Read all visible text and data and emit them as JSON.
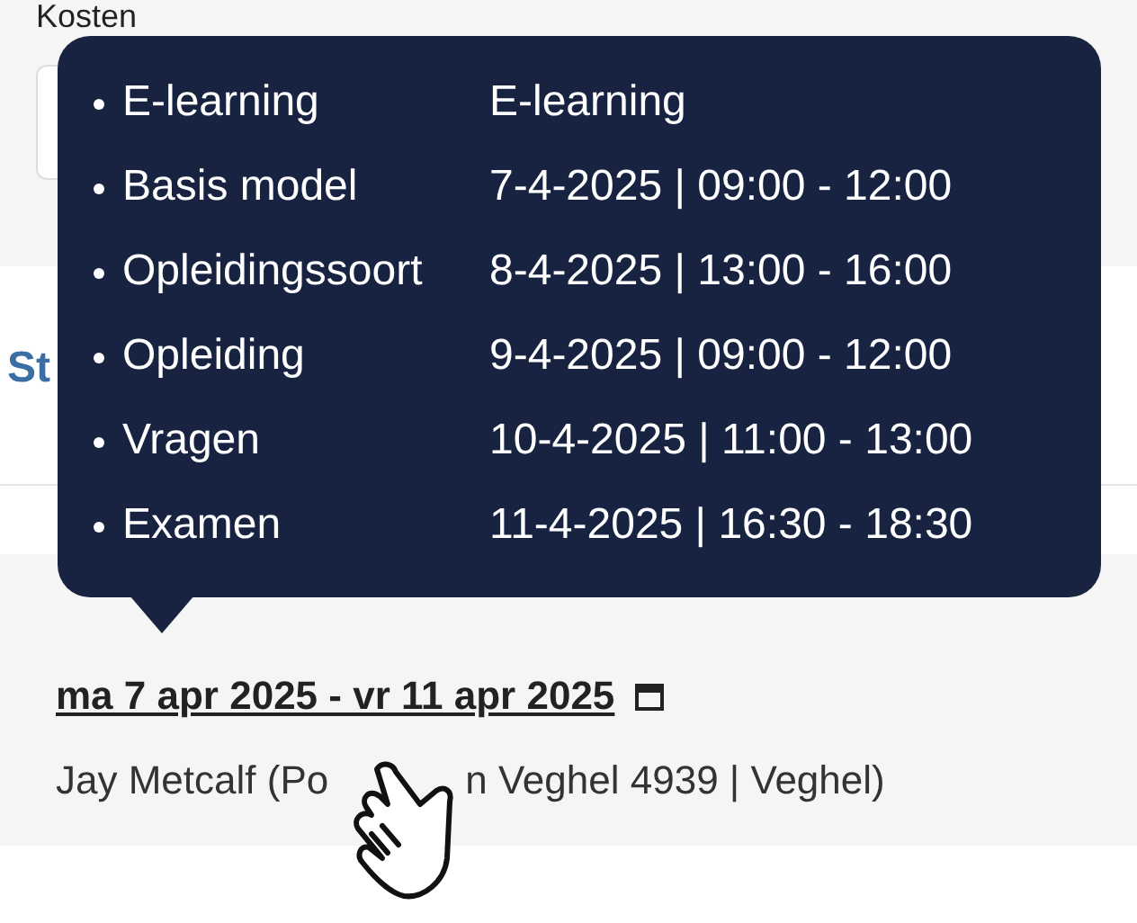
{
  "section_label": "Kosten",
  "section_heading": "St",
  "tooltip": {
    "rows": [
      {
        "label": "E-learning",
        "value": "E-learning"
      },
      {
        "label": "Basis model",
        "value": "7-4-2025 | 09:00 - 12:00"
      },
      {
        "label": "Opleidingssoort",
        "value": "8-4-2025 | 13:00 - 16:00"
      },
      {
        "label": "Opleiding",
        "value": "9-4-2025 | 09:00 - 12:00"
      },
      {
        "label": "Vragen",
        "value": "10-4-2025 | 11:00 - 13:00"
      },
      {
        "label": "Examen",
        "value": "11-4-2025 | 16:30 - 18:30"
      }
    ]
  },
  "date_link": "ma 7 apr 2025 - vr 11 apr 2025",
  "location_parts": [
    "Jay Metcalf (Po",
    "n Veghel 4939 | Veghel)"
  ]
}
